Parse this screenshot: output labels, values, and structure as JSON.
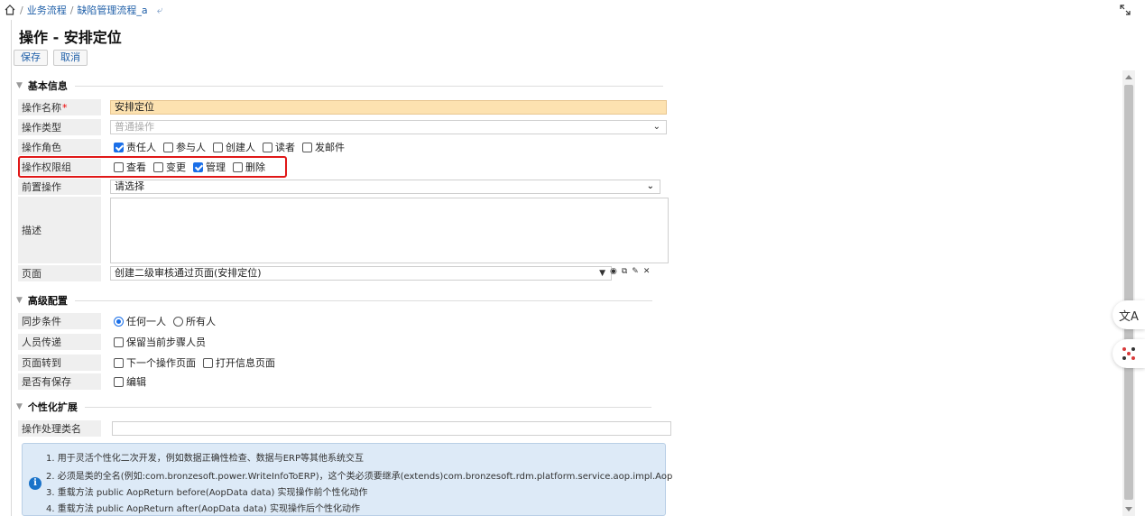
{
  "breadcrumb": {
    "items": [
      "业务流程",
      "缺陷管理流程_a"
    ],
    "separator": "/"
  },
  "page_title": "操作 - 安排定位",
  "toolbar": {
    "save_label": "保存",
    "cancel_label": "取消"
  },
  "sections": {
    "basic": "基本信息",
    "advanced": "高级配置",
    "custom": "个性化扩展"
  },
  "basic": {
    "name_label": "操作名称",
    "name_required": "*",
    "name_value": "安排定位",
    "type_label": "操作类型",
    "type_value": "普通操作",
    "role_label": "操作角色",
    "roles": [
      {
        "label": "责任人",
        "checked": true
      },
      {
        "label": "参与人",
        "checked": false
      },
      {
        "label": "创建人",
        "checked": false
      },
      {
        "label": "读者",
        "checked": false
      },
      {
        "label": "发邮件",
        "checked": false
      }
    ],
    "perm_label": "操作权限组",
    "perms": [
      {
        "label": "查看",
        "checked": false
      },
      {
        "label": "变更",
        "checked": false
      },
      {
        "label": "管理",
        "checked": true
      },
      {
        "label": "删除",
        "checked": false
      }
    ],
    "pre_label": "前置操作",
    "pre_value": "请选择",
    "desc_label": "描述",
    "page_label": "页面",
    "page_value": "创建二级审核通过页面(安排定位)"
  },
  "advanced": {
    "sync_label": "同步条件",
    "sync_options": [
      {
        "label": "任何一人",
        "checked": true
      },
      {
        "label": "所有人",
        "checked": false
      }
    ],
    "pass_label": "人员传递",
    "pass_option": "保留当前步骤人员",
    "jump_label": "页面转到",
    "jump_options": [
      "下一个操作页面",
      "打开信息页面"
    ],
    "save_label": "是否有保存",
    "save_option": "编辑"
  },
  "custom": {
    "class_label": "操作处理类名",
    "class_value": "",
    "notes": [
      "1. 用于灵活个性化二次开发，例如数据正确性检查、数据与ERP等其他系统交互",
      "2. 必须是类的全名(例如:com.bronzesoft.power.WriteInfoToERP)，这个类必须要继承(extends)com.bronzesoft.rdm.platform.service.aop.impl.Aop",
      "3. 重载方法 public AopReturn before(AopData data) 实现操作前个性化动作",
      "4. 重载方法 public AopReturn after(AopData data) 实现操作后个性化动作"
    ]
  },
  "colors": {
    "accent": "#1a6fe8",
    "link": "#1f5fa8",
    "highlight": "#e01818",
    "required_input_bg": "#fde2b0"
  }
}
